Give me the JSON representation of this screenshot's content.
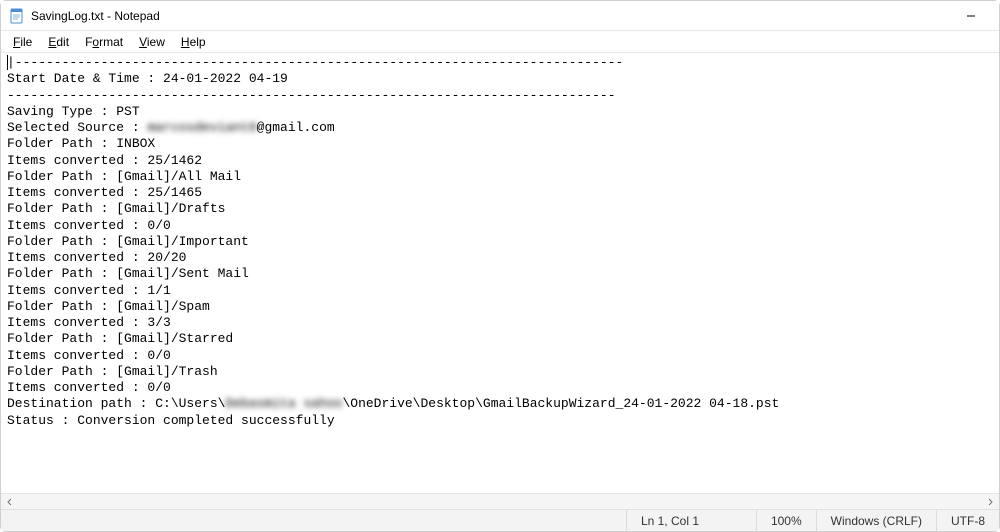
{
  "titlebar": {
    "title": "SavingLog.txt - Notepad"
  },
  "menubar": {
    "file": "File",
    "edit": "Edit",
    "format": "Format",
    "view": "View",
    "help": "Help"
  },
  "content": {
    "separator1": "|------------------------------------------------------------------------------",
    "start_datetime": "Start Date & Time : 24-01-2022 04-19",
    "separator2": "------------------------------------------------------------------------------",
    "saving_type": "Saving Type : PST",
    "selected_source_prefix": "Selected Source : ",
    "selected_source_blur": "marcosdeviant8",
    "selected_source_suffix": "@gmail.com",
    "folder_inbox": "Folder Path : INBOX",
    "items_inbox": "Items converted : 25/1462",
    "folder_allmail": "Folder Path : [Gmail]/All Mail",
    "items_allmail": "Items converted : 25/1465",
    "folder_drafts": "Folder Path : [Gmail]/Drafts",
    "items_drafts": "Items converted : 0/0",
    "folder_important": "Folder Path : [Gmail]/Important",
    "items_important": "Items converted : 20/20",
    "folder_sent": "Folder Path : [Gmail]/Sent Mail",
    "items_sent": "Items converted : 1/1",
    "folder_spam": "Folder Path : [Gmail]/Spam",
    "items_spam": "Items converted : 3/3",
    "folder_starred": "Folder Path : [Gmail]/Starred",
    "items_starred": "Items converted : 0/0",
    "folder_trash": "Folder Path : [Gmail]/Trash",
    "items_trash": "Items converted : 0/0",
    "destination_prefix": "Destination path : C:\\Users\\",
    "destination_blur": "Debasmita sahoo",
    "destination_suffix": "\\OneDrive\\Desktop\\GmailBackupWizard_24-01-2022 04-18.pst",
    "status_line": "Status : Conversion completed successfully"
  },
  "statusbar": {
    "position": "Ln 1, Col 1",
    "zoom": "100%",
    "line_ending": "Windows (CRLF)",
    "encoding": "UTF-8"
  }
}
